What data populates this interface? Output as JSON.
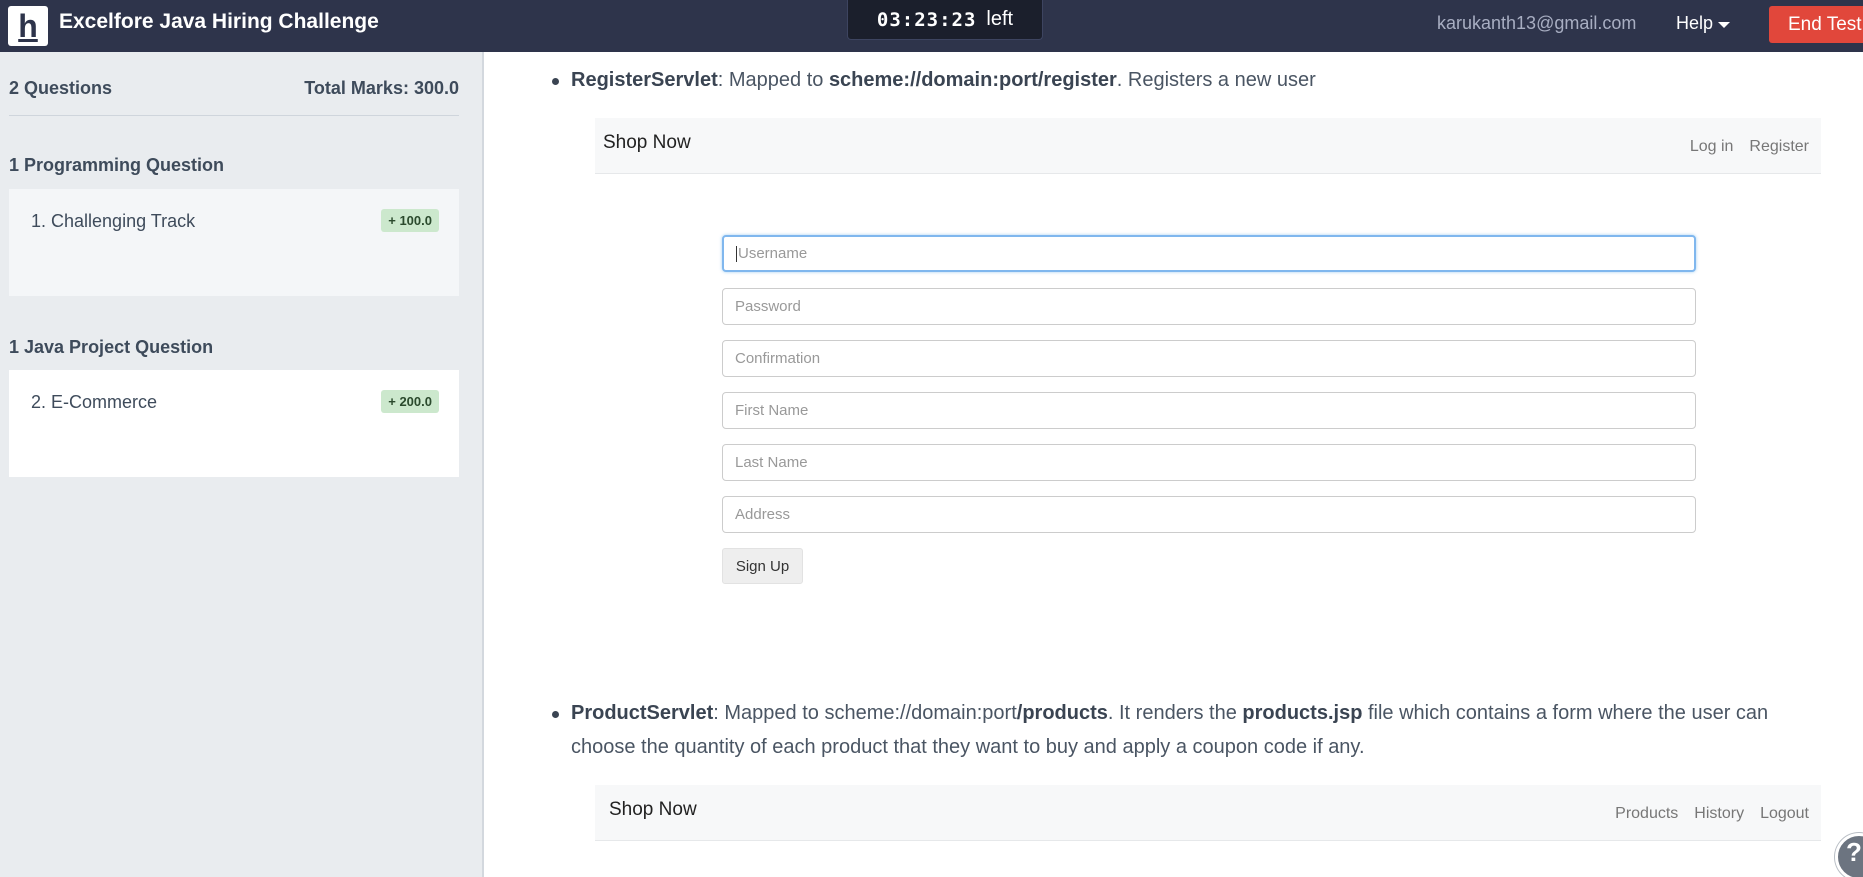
{
  "header": {
    "logo_letter": "h",
    "title": "Excelfore Java Hiring Challenge",
    "timer": "03:23:23",
    "timer_suffix": "left",
    "email": "karukanth13@gmail.com",
    "help_label": "Help",
    "end_test_label": "End Test"
  },
  "sidebar": {
    "question_count": "2 Questions",
    "total_marks": "Total Marks: 300.0",
    "sections": [
      {
        "title": "1 Programming Question",
        "question": {
          "label": "1. Challenging Track",
          "badge": "+ 100.0"
        }
      },
      {
        "title": "1 Java Project Question",
        "question": {
          "label": "2. E-Commerce",
          "badge": "+ 200.0"
        }
      }
    ]
  },
  "content": {
    "register": {
      "servlet": "RegisterServlet",
      "text_1": ": Mapped to ",
      "url": "scheme://domain:port/register",
      "text_2": ". Registers a new user",
      "mock": {
        "brand": "Shop Now",
        "links": [
          "Log in",
          "Register"
        ],
        "fields": [
          {
            "placeholder": "Username"
          },
          {
            "placeholder": "Password"
          },
          {
            "placeholder": "Confirmation"
          },
          {
            "placeholder": "First Name"
          },
          {
            "placeholder": "Last Name"
          },
          {
            "placeholder": "Address"
          }
        ],
        "submit_label": "Sign Up"
      }
    },
    "product": {
      "servlet": "ProductServlet",
      "text_1": ": Mapped to scheme://domain:port",
      "url": "/products",
      "text_2": ". It renders the ",
      "file": "products.jsp",
      "text_3": " file which contains a form where the user can",
      "text_4": "choose the quantity of each product that they want to buy and apply a coupon code if any.",
      "mock": {
        "brand": "Shop Now",
        "links": [
          "Products",
          "History",
          "Logout"
        ]
      }
    },
    "help_bubble": "?"
  }
}
